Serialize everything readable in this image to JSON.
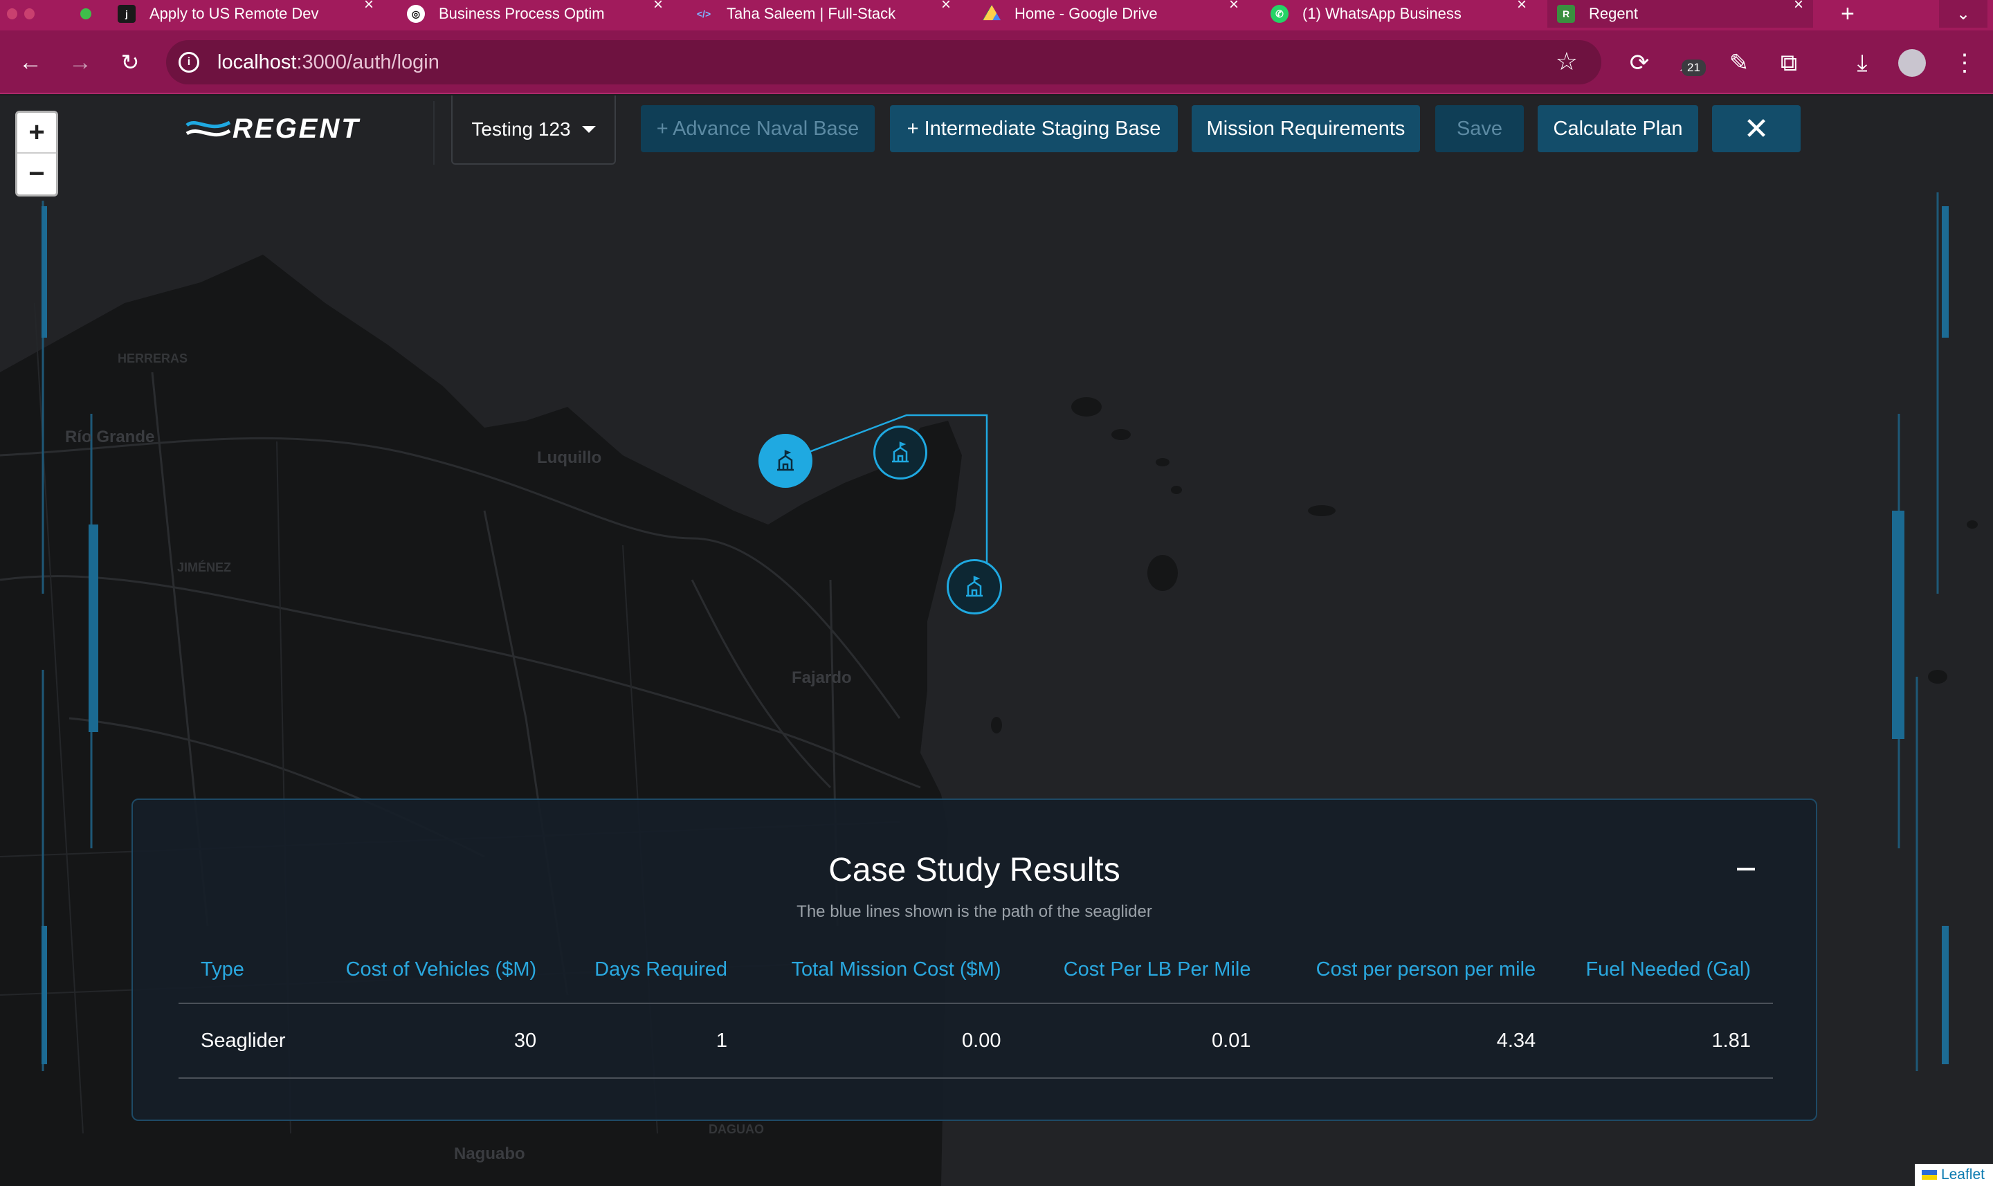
{
  "browser": {
    "tabs": [
      {
        "title": "Apply to US Remote Dev",
        "icon": "job-site-icon"
      },
      {
        "title": "Business Process Optim",
        "icon": "openai-icon"
      },
      {
        "title": "Taha Saleem | Full-Stack",
        "icon": "code-icon"
      },
      {
        "title": "Home - Google Drive",
        "icon": "google-drive-icon"
      },
      {
        "title": "(1) WhatsApp Business",
        "icon": "whatsapp-icon"
      },
      {
        "title": "Regent",
        "icon": "regent-icon"
      }
    ],
    "url_host": "localhost",
    "url_path": ":3000/auth/login",
    "extension_badge": "21"
  },
  "app": {
    "logo_text": "REGENT",
    "case_selector": "Testing 123",
    "buttons": {
      "advance_naval_base": "+ Advance Naval Base",
      "intermediate_staging_base": "+ Intermediate Staging Base",
      "mission_requirements": "Mission Requirements",
      "save": "Save",
      "calculate_plan": "Calculate Plan"
    },
    "zoom_in": "+",
    "zoom_out": "−",
    "map_labels": {
      "herreras": "HERRERAS",
      "rio_grande": "Río Grande",
      "luquillo": "Luquillo",
      "jimenez": "JIMÉNEZ",
      "fajardo": "Fajardo",
      "naguabo": "Naguabo",
      "daguao": "DAGUAO"
    },
    "attribution": "Leaflet",
    "accent_color": "#1fa9e1"
  },
  "results": {
    "title": "Case Study Results",
    "subtitle": "The blue lines shown is the path of the seaglider",
    "columns": [
      "Type",
      "Cost of Vehicles ($M)",
      "Days Required",
      "Total Mission Cost ($M)",
      "Cost Per LB Per Mile",
      "Cost per person per mile",
      "Fuel Needed (Gal)"
    ],
    "rows": [
      [
        "Seaglider",
        "30",
        "1",
        "0.00",
        "0.01",
        "4.34",
        "1.81"
      ]
    ]
  }
}
